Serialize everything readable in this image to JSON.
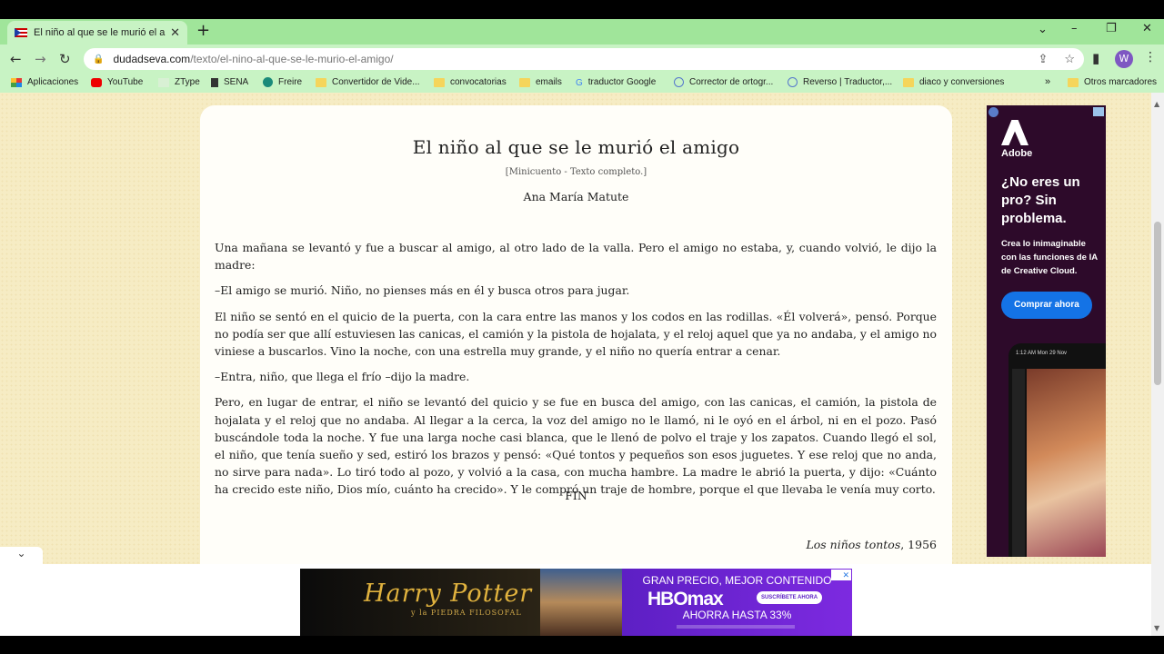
{
  "browser": {
    "tab_title": "El niño al que se le murió el amig",
    "new_tab": "+",
    "url_host": "dudadseva.com",
    "url_path": "/texto/el-nino-al-que-se-le-murio-el-amigo/",
    "profile_initial": "W"
  },
  "bookmarks": [
    {
      "label": "Aplicaciones",
      "icon": "apps-grid-icon"
    },
    {
      "label": "YouTube",
      "icon": "youtube-icon"
    },
    {
      "label": "ZType",
      "icon": "folder-icon"
    },
    {
      "label": "SENA",
      "icon": "sena-icon"
    },
    {
      "label": "Freire",
      "icon": "freire-icon"
    },
    {
      "label": "Convertidor de Vide...",
      "icon": "folder-icon"
    },
    {
      "label": "convocatorias",
      "icon": "folder-icon"
    },
    {
      "label": "emails",
      "icon": "folder-icon"
    },
    {
      "label": "traductor Google",
      "icon": "google-icon"
    },
    {
      "label": "Corrector de ortogr...",
      "icon": "corrector-icon"
    },
    {
      "label": "Reverso | Traductor,...",
      "icon": "reverso-icon"
    },
    {
      "label": "diaco y conversiones",
      "icon": "folder-icon"
    },
    {
      "label": "»",
      "icon": ""
    },
    {
      "label": "Otros marcadores",
      "icon": "folder-icon"
    }
  ],
  "story": {
    "title": "El niño al que se le murió el amigo",
    "subtitle": "[Minicuento - Texto completo.]",
    "author": "Ana María Matute",
    "paragraphs": [
      "Una mañana se levantó y fue a buscar al amigo, al otro lado de la valla. Pero el amigo no estaba, y, cuando volvió, le dijo la madre:",
      "–El amigo se murió. Niño, no pienses más en él y busca otros para jugar.",
      "El niño se sentó en el quicio de la puerta, con la cara entre las manos y los codos en las rodillas. «Él volverá», pensó. Porque no podía ser que allí estuviesen las canicas, el camión y la pistola de hojalata, y el reloj aquel que ya no andaba, y el amigo no viniese a buscarlos. Vino la noche, con una estrella muy grande, y el niño no quería entrar a cenar.",
      "–Entra, niño, que llega el frío –dijo la madre.",
      "Pero, en lugar de entrar, el niño se levantó del quicio y se fue en busca del amigo, con las canicas, el camión, la pistola de hojalata y el reloj que no andaba. Al llegar a la cerca, la voz del amigo no le llamó, ni le oyó en el árbol, ni en el pozo. Pasó buscándole toda la noche. Y fue una larga noche casi blanca, que le llenó de polvo el traje y los zapatos. Cuando llegó el sol, el niño, que tenía sueño y sed, estiró los brazos y pensó: «Qué tontos y pequeños son esos juguetes. Y ese reloj que no anda, no sirve para nada». Lo tiró todo al pozo, y volvió a la casa, con mucha hambre. La madre le abrió la puerta, y dijo: «Cuánto ha crecido este niño, Dios mío, cuánto ha crecido». Y le compró un traje de hombre, porque el que llevaba le venía muy corto."
    ],
    "fin": "FIN",
    "source_book": "Los niños tontos",
    "source_year": ", 1956"
  },
  "side_ad": {
    "brand": "Adobe",
    "headline": "¿No eres un pro? Sin problema.",
    "body": "Crea lo inimaginable con las funciones de IA de Creative Cloud.",
    "button": "Comprar ahora",
    "phone_time": "1:12 AM   Mon 29 Nov"
  },
  "bottom_ad": {
    "hp_title": "Harry Potter",
    "hp_sub": "y la PIEDRA FILOSOFAL",
    "hbo_top": "GRAN PRECIO, MEJOR CONTENIDO",
    "hbo_logo": "HBOmax",
    "hbo_subscribe": "SUSCRÍBETE AHORA",
    "hbo_offer": "AHORRA HASTA 33%"
  },
  "colors": {
    "tabstrip": "#a0e59a",
    "toolbar": "#c8f3c4",
    "page_bg": "#f6ecc4",
    "adobe_button": "#1473e6",
    "hbo_purple": "#5d1fc4"
  }
}
